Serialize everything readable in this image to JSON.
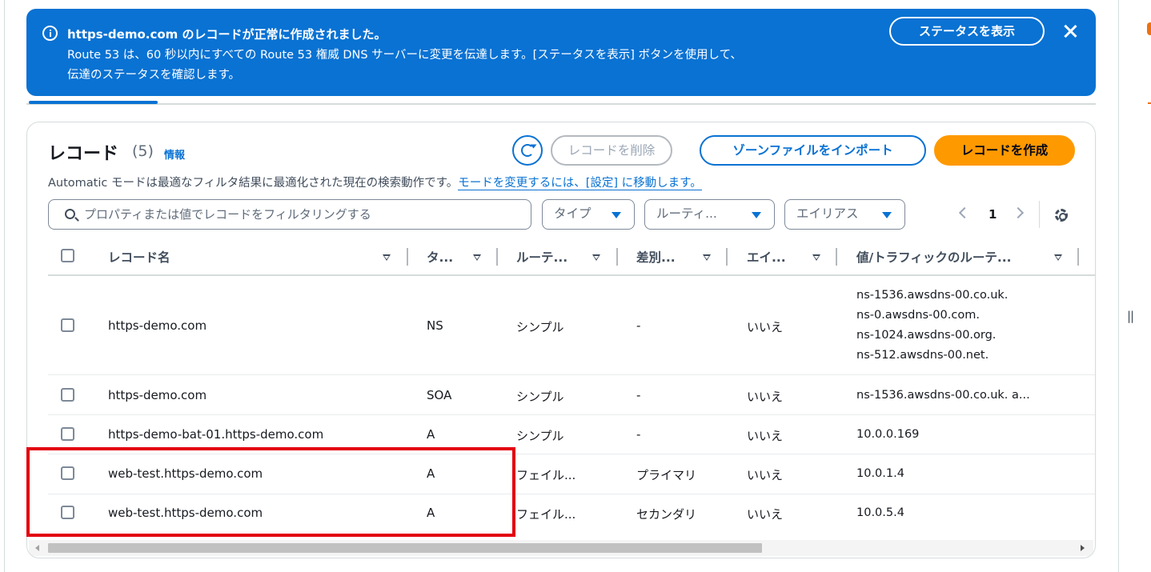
{
  "flash": {
    "title": "https-demo.com のレコードが正常に作成されました。",
    "line1": "Route 53 は、60 秒以内にすべての Route 53 権威 DNS サーバーに変更を伝達します。[ステータスを表示] ボタンを使用して、",
    "line2": "伝達のステータスを確認します。",
    "view_status_label": "ステータスを表示",
    "color": "#0972d3"
  },
  "records": {
    "title": "レコード",
    "count": "(5)",
    "info_link": "情報",
    "description": "Automatic モードは最適なフィルタ結果に最適化された現在の検索動作です。",
    "description_link": "モードを変更するには、[設定] に移動します。",
    "delete_label": "レコードを削除",
    "import_label": "ゾーンファイルをインポート",
    "create_label": "レコードを作成",
    "primary_color": "#ff9900",
    "search_placeholder": "プロパティまたは値でレコードをフィルタリングする",
    "filters": {
      "type": "タイプ",
      "routing": "ルーティ...",
      "alias": "エイリアス"
    },
    "page": "1",
    "columns": [
      "レコード名",
      "タ...",
      "ルーテ...",
      "差別...",
      "エイ...",
      "値/トラフィックのルーテ..."
    ],
    "rows": [
      {
        "name": "https-demo.com",
        "type": "NS",
        "routing": "シンプル",
        "differentiator": "-",
        "alias": "いいえ",
        "value": [
          "ns-1536.awsdns-00.co.uk.",
          "ns-0.awsdns-00.com.",
          "ns-1024.awsdns-00.org.",
          "ns-512.awsdns-00.net."
        ]
      },
      {
        "name": "https-demo.com",
        "type": "SOA",
        "routing": "シンプル",
        "differentiator": "-",
        "alias": "いいえ",
        "value": [
          "ns-1536.awsdns-00.co.uk. a..."
        ]
      },
      {
        "name": "https-demo-bat-01.https-demo.com",
        "type": "A",
        "routing": "シンプル",
        "differentiator": "-",
        "alias": "いいえ",
        "value": [
          "10.0.0.169"
        ]
      },
      {
        "name": "web-test.https-demo.com",
        "type": "A",
        "routing": "フェイル...",
        "differentiator": "プライマリ",
        "alias": "いいえ",
        "value": [
          "10.0.1.4"
        ]
      },
      {
        "name": "web-test.https-demo.com",
        "type": "A",
        "routing": "フェイル...",
        "differentiator": "セカンダリ",
        "alias": "いいえ",
        "value": [
          "10.0.5.4"
        ]
      }
    ]
  }
}
